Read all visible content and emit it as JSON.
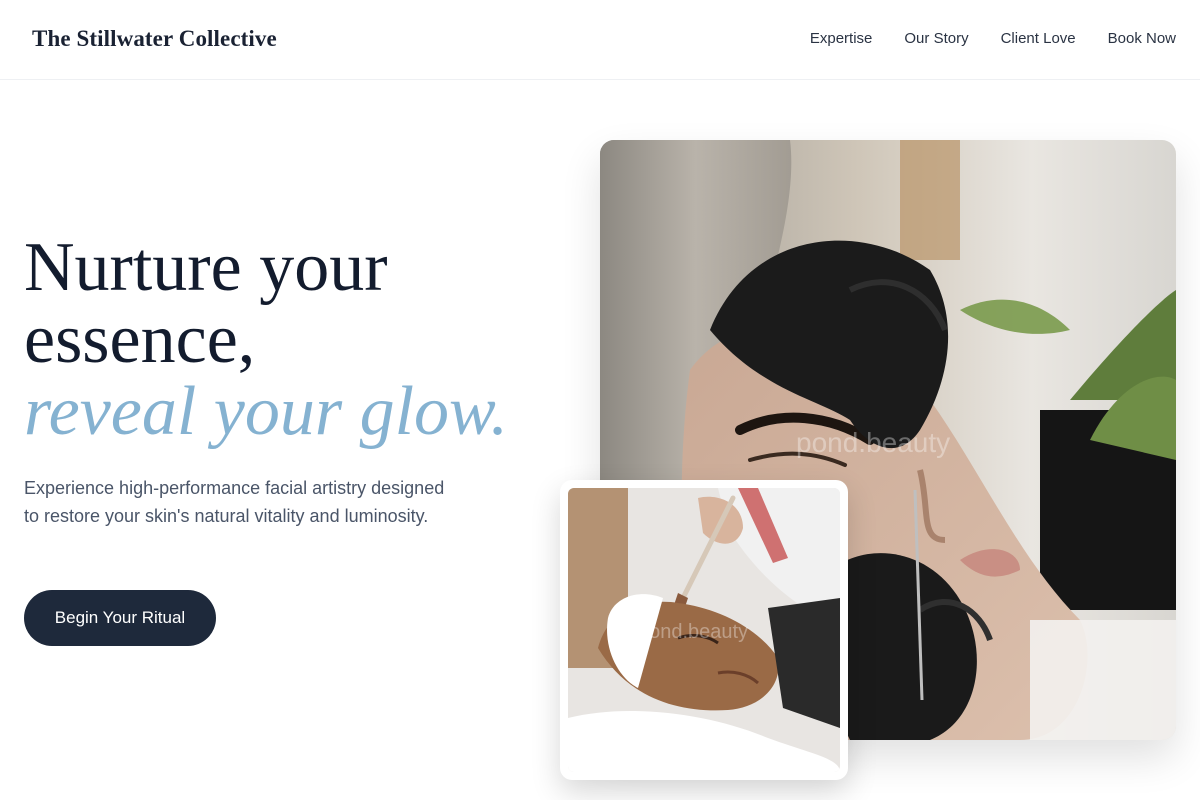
{
  "brand": {
    "name": "The Stillwater Collective"
  },
  "nav": {
    "items": [
      {
        "label": "Expertise"
      },
      {
        "label": "Our Story"
      },
      {
        "label": "Client Love"
      },
      {
        "label": "Book Now"
      }
    ]
  },
  "hero": {
    "title_line1": "Nurture your",
    "title_line2": "essence,",
    "title_accent": "reveal your glow.",
    "description": "Experience high-performance facial artistry designed to restore your skin's natural vitality and luminosity.",
    "cta_label": "Begin Your Ritual"
  },
  "images": {
    "main_watermark": "pond.beauty",
    "sub_watermark": "pond.beauty"
  },
  "colors": {
    "accent": "#85b2d1",
    "button": "#1e293b",
    "text_dark": "#131c2e"
  }
}
